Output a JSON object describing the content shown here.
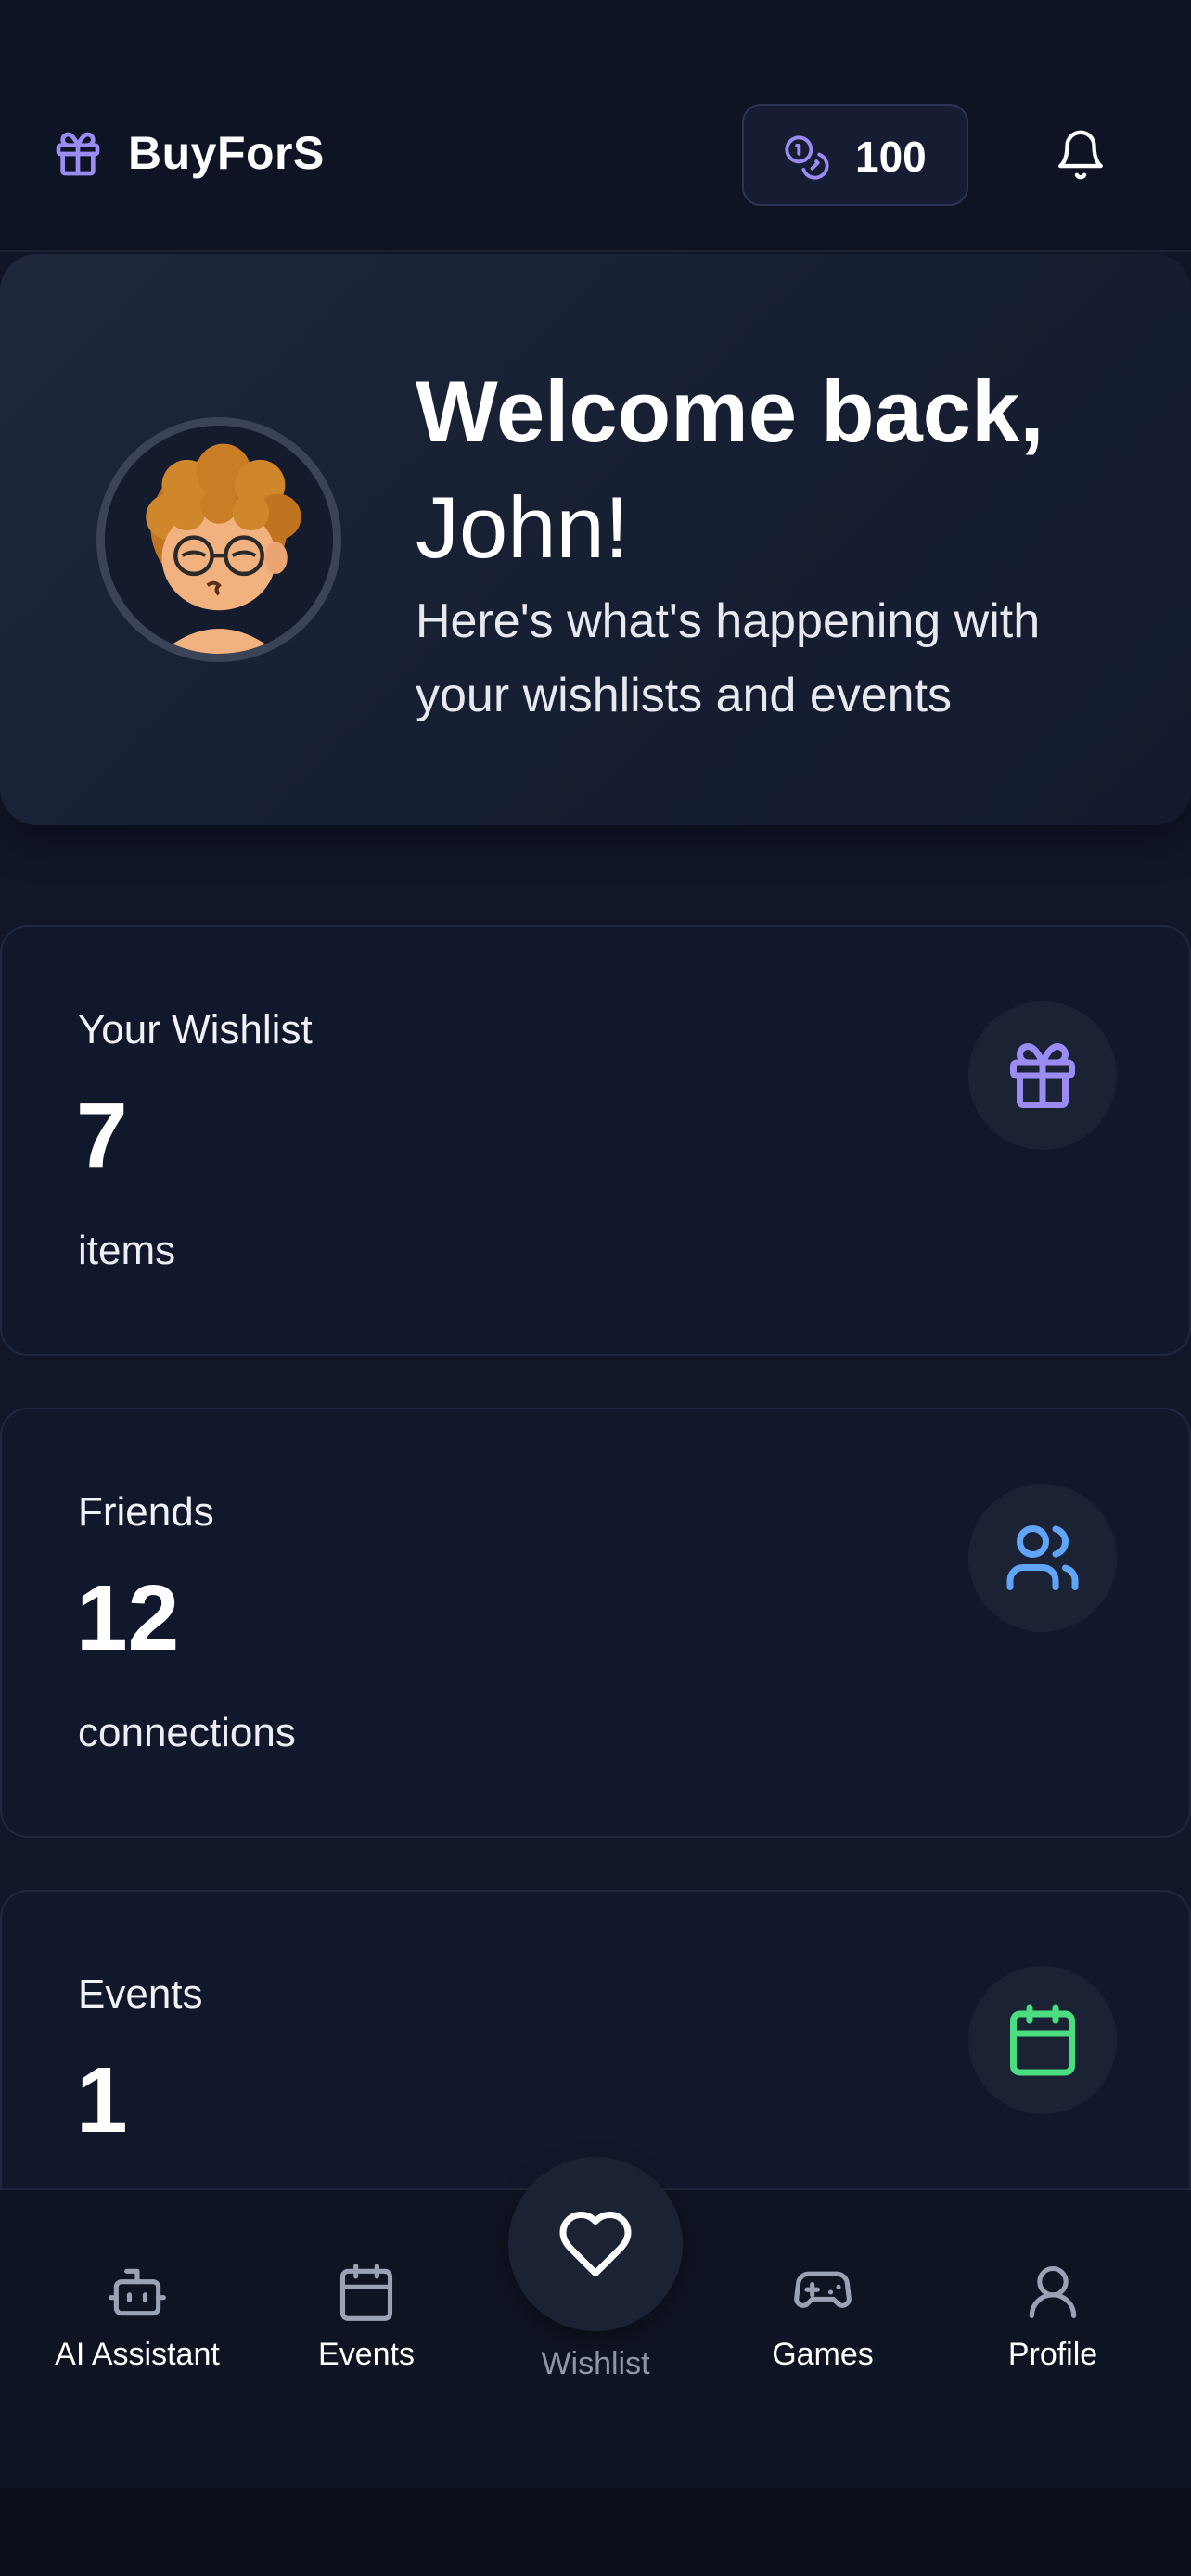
{
  "header": {
    "brand": "BuyForS",
    "coins": "100",
    "icons": {
      "logo": "gift-icon",
      "coins": "coins-icon",
      "notifications": "bell-icon"
    }
  },
  "welcome": {
    "title": "Welcome back,",
    "name": "John!",
    "subtitle": "Here's what's happening with your wishlists and events"
  },
  "stats": [
    {
      "label": "Your Wishlist",
      "value": "7",
      "unit": "items",
      "icon": "gift-icon",
      "color": "#9b8cf4"
    },
    {
      "label": "Friends",
      "value": "12",
      "unit": "connections",
      "icon": "users-icon",
      "color": "#60a5fa"
    },
    {
      "label": "Events",
      "value": "1",
      "unit": "",
      "icon": "calendar-icon",
      "color": "#4ade80"
    }
  ],
  "nav": {
    "items": [
      {
        "label": "AI Assistant",
        "icon": "robot-icon"
      },
      {
        "label": "Events",
        "icon": "calendar-icon"
      },
      {
        "label": "Wishlist",
        "icon": "heart-icon",
        "active": true
      },
      {
        "label": "Games",
        "icon": "gamepad-icon"
      },
      {
        "label": "Profile",
        "icon": "user-icon"
      }
    ]
  },
  "colors": {
    "background": "#111729",
    "accent_purple": "#9b8cf4",
    "accent_blue": "#60a5fa",
    "accent_green": "#4ade80",
    "muted_text": "#8e96a8"
  }
}
